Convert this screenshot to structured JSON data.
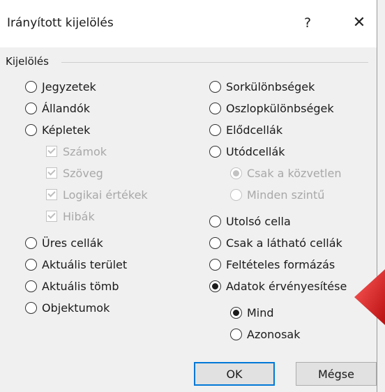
{
  "dialog": {
    "title": "Irányított kijelölés",
    "help_label": "?",
    "close_label": "✕",
    "group_label": "Kijelölés"
  },
  "left_options": [
    {
      "label": "Jegyzetek",
      "type": "radio",
      "checked": false,
      "enabled": true
    },
    {
      "label": "Állandók",
      "type": "radio",
      "checked": false,
      "enabled": true
    },
    {
      "label": "Képletek",
      "type": "radio",
      "checked": false,
      "enabled": true
    },
    {
      "label": "Számok",
      "type": "checkbox",
      "checked": true,
      "enabled": false
    },
    {
      "label": "Szöveg",
      "type": "checkbox",
      "checked": true,
      "enabled": false
    },
    {
      "label": "Logikai értékek",
      "type": "checkbox",
      "checked": true,
      "enabled": false
    },
    {
      "label": "Hibák",
      "type": "checkbox",
      "checked": true,
      "enabled": false
    },
    {
      "label": "Üres cellák",
      "type": "radio",
      "checked": false,
      "enabled": true
    },
    {
      "label": "Aktuális terület",
      "type": "radio",
      "checked": false,
      "enabled": true
    },
    {
      "label": "Aktuális tömb",
      "type": "radio",
      "checked": false,
      "enabled": true
    },
    {
      "label": "Objektumok",
      "type": "radio",
      "checked": false,
      "enabled": true
    }
  ],
  "right_options": [
    {
      "label": "Sorkülönbségek",
      "type": "radio",
      "checked": false,
      "enabled": true
    },
    {
      "label": "Oszlopkülönbségek",
      "type": "radio",
      "checked": false,
      "enabled": true
    },
    {
      "label": "Elődcellák",
      "type": "radio",
      "checked": false,
      "enabled": true
    },
    {
      "label": "Utódcellák",
      "type": "radio",
      "checked": false,
      "enabled": true
    },
    {
      "label": "Csak a közvetlen",
      "type": "radio",
      "checked": true,
      "enabled": false
    },
    {
      "label": "Minden szintű",
      "type": "radio",
      "checked": false,
      "enabled": false
    },
    {
      "label": "Utolsó cella",
      "type": "radio",
      "checked": false,
      "enabled": true
    },
    {
      "label": "Csak a látható cellák",
      "type": "radio",
      "checked": false,
      "enabled": true
    },
    {
      "label": "Feltételes formázás",
      "type": "radio",
      "checked": false,
      "enabled": true
    },
    {
      "label": "Adatok érvényesítése",
      "type": "radio",
      "checked": true,
      "enabled": true
    },
    {
      "label": "Mind",
      "type": "radio",
      "checked": true,
      "enabled": true
    },
    {
      "label": "Azonosak",
      "type": "radio",
      "checked": false,
      "enabled": true
    }
  ],
  "buttons": {
    "ok_label": "OK",
    "cancel_label": "Mégse"
  },
  "colors": {
    "accent": "#0078d7",
    "arrow": "#d41f1f"
  },
  "icons": {
    "help": "question-mark-icon",
    "close": "close-icon",
    "annotation": "red-arrow-icon"
  }
}
